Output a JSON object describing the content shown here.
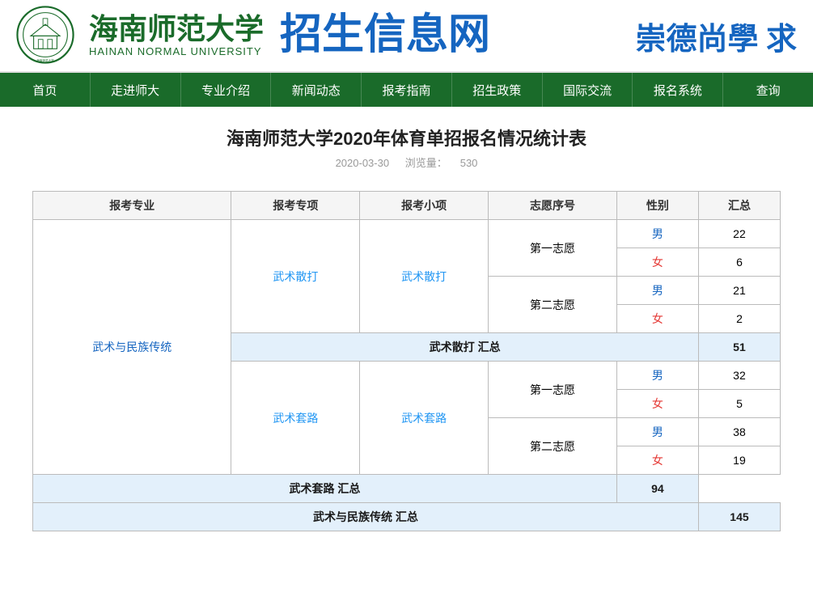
{
  "header": {
    "university_cn": "海南师范大学",
    "university_en": "HAINAN NORMAL UNIVERSITY",
    "site_name": "招生信息网",
    "slogan": "崇德尚學 求",
    "logo_alt": "海南师范大学校徽"
  },
  "nav": {
    "items": [
      "首页",
      "走进师大",
      "专业介绍",
      "新闻动态",
      "报考指南",
      "招生政策",
      "国际交流",
      "报名系统",
      "查询"
    ]
  },
  "page": {
    "title": "海南师范大学2020年体育单招报名情况统计表",
    "date": "2020-03-30",
    "view_label": "浏览量：",
    "view_count": "530"
  },
  "table": {
    "headers": [
      "报考专业",
      "报考专项",
      "报考小项",
      "志愿序号",
      "性别",
      "汇总"
    ],
    "rows": [
      {
        "type": "data",
        "major": "武术与民族传统",
        "subitem_group": "武术散打",
        "subitem": "武术散打",
        "wish": "第一志愿",
        "gender": "男",
        "count": "22"
      },
      {
        "type": "data",
        "major": "",
        "subitem_group": "",
        "subitem": "",
        "wish": "",
        "gender": "女",
        "count": "6"
      },
      {
        "type": "data",
        "major": "",
        "subitem_group": "",
        "subitem": "",
        "wish": "第二志愿",
        "gender": "男",
        "count": "21"
      },
      {
        "type": "data",
        "major": "",
        "subitem_group": "",
        "subitem": "",
        "wish": "",
        "gender": "女",
        "count": "2"
      },
      {
        "type": "summary",
        "label": "武术散打 汇总",
        "count": "51"
      },
      {
        "type": "data",
        "major": "",
        "subitem_group": "武术套路",
        "subitem": "武术套路",
        "wish": "第一志愿",
        "gender": "男",
        "count": "32"
      },
      {
        "type": "data",
        "major": "",
        "subitem_group": "",
        "subitem": "",
        "wish": "",
        "gender": "女",
        "count": "5"
      },
      {
        "type": "data",
        "major": "",
        "subitem_group": "",
        "subitem": "",
        "wish": "第二志愿",
        "gender": "男",
        "count": "38"
      },
      {
        "type": "data",
        "major": "",
        "subitem_group": "",
        "subitem": "",
        "wish": "",
        "gender": "女",
        "count": "19"
      },
      {
        "type": "summary",
        "label": "武术套路 汇总",
        "count": "94"
      },
      {
        "type": "summary",
        "label": "武术与民族传统 汇总",
        "count": "145"
      }
    ]
  },
  "colors": {
    "nav_bg": "#1a6b2a",
    "header_green": "#1a6b2a",
    "header_blue": "#1565c0",
    "summary_bg": "#e3f0fb",
    "male": "#1565c0",
    "female": "#e53935"
  }
}
